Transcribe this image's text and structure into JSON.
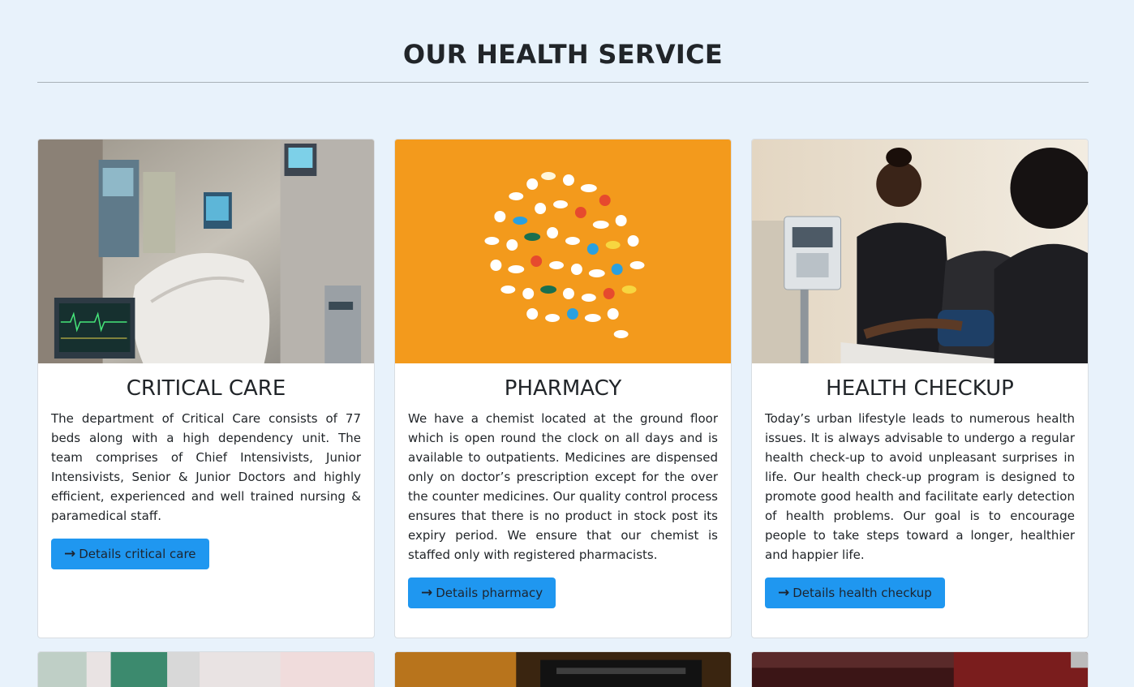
{
  "header": {
    "title": "OUR HEALTH SERVICE"
  },
  "cards": [
    {
      "title": "CRITICAL CARE",
      "text": "The department of Critical Care consists of 77 beds along with a high dependency unit. The team comprises of Chief Intensivists, Junior Intensivists, Senior & Junior Doctors and highly efficient, experienced and well trained nursing & paramedical staff.",
      "button_label": "Details critical care",
      "image": "icu-room-photo"
    },
    {
      "title": "PHARMACY",
      "text": "We have a chemist located at the ground floor which is open round the clock on all days and is available to outpatients. Medicines are dispensed only on doctor’s prescription except for the over the counter medicines. Our quality control process ensures that there is no product in stock post its expiry period. We ensure that our chemist is staffed only with registered pharmacists.",
      "button_label": "Details pharmacy",
      "image": "pills-photo"
    },
    {
      "title": "HEALTH CHECKUP",
      "text": "Today’s urban lifestyle leads to numerous health issues. It is always advisable to undergo a regular health check-up to avoid unpleasant surprises in life. Our health check-up program is designed to promote good health and facilitate early detection of health problems. Our goal is to encourage people to take steps toward a longer, healthier and happier life.",
      "button_label": "Details health checkup",
      "image": "blood-pressure-check-photo"
    }
  ],
  "colors": {
    "page_background": "#e8f2fb",
    "button": "#1f97f0",
    "pharmacy_orange": "#f39a1c"
  },
  "icons": {
    "button_icon": "arrow-right-icon"
  }
}
